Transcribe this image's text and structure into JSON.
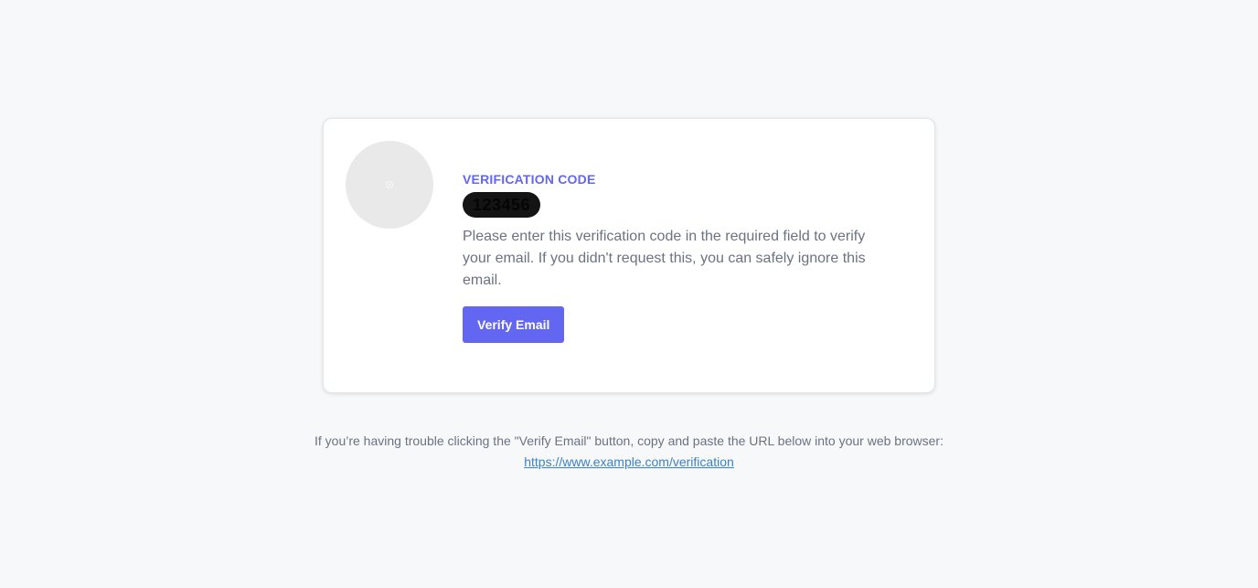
{
  "card": {
    "avatar_icon": "placeholder-avatar-icon",
    "code_label": "VERIFICATION CODE",
    "code_value": "123456",
    "message": "Please enter this verification code in the required field to verify your email. If you didn't request this, you can safely ignore this email.",
    "button_label": "Verify Email"
  },
  "footer": {
    "help_text": "If you’re having trouble clicking the \"Verify Email\" button, copy and paste the URL below into your web browser:",
    "url": "https://www.example.com/verification"
  },
  "colors": {
    "accent": "#6366f1",
    "background": "#f7f8fa",
    "link": "#3b82c4",
    "body_text": "#6b7280"
  }
}
